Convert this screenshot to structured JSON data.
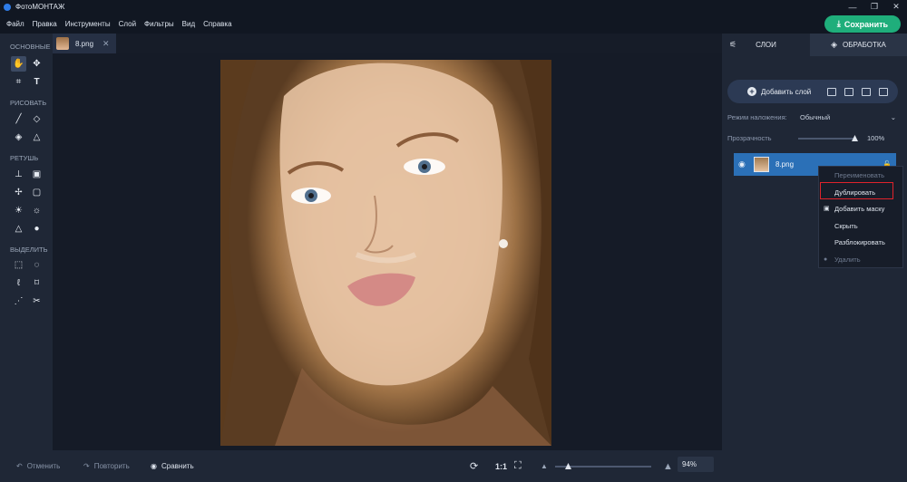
{
  "app": {
    "title": "ФотоМОНТАЖ",
    "accent": "#1fae7b",
    "selection": "#2b70b7"
  },
  "menu": [
    "Файл",
    "Правка",
    "Инструменты",
    "Слой",
    "Фильтры",
    "Вид",
    "Справка"
  ],
  "save_label": "Сохранить",
  "tools": {
    "sections": [
      "ОСНОВНЫЕ",
      "РИСОВАТЬ",
      "РЕТУШЬ",
      "ВЫДЕЛИТЬ"
    ]
  },
  "document": {
    "name": "8.png",
    "close": "✕"
  },
  "bottom": {
    "undo": "Отменить",
    "redo": "Повторить",
    "compare": "Сравнить",
    "ratio": "1:1",
    "zoom": "94%",
    "zoom_level": 0.1
  },
  "right_panel": {
    "tabs": [
      "СЛОИ",
      "ОБРАБОТКА"
    ],
    "add_layer": "Добавить слой",
    "blend_label": "Режим наложения:",
    "blend_value": "Обычный",
    "opacity_label": "Прозрачность",
    "opacity_value": "100%",
    "layer_name": "8.png"
  },
  "context_menu": [
    "Переименовать",
    "Дублировать",
    "Добавить маску",
    "Скрыть",
    "Разблокировать",
    "Удалить"
  ]
}
